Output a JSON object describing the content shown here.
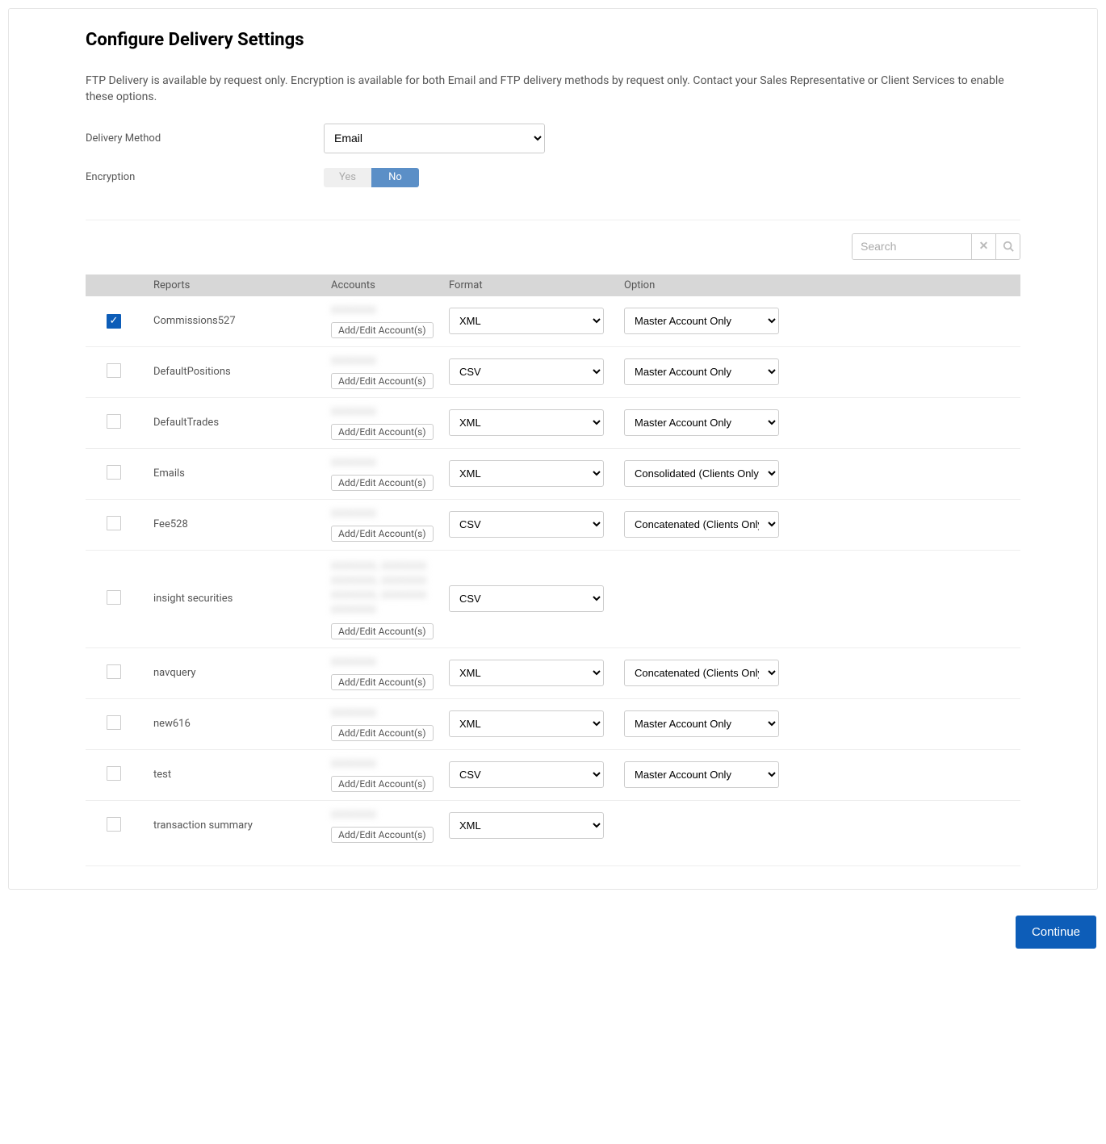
{
  "page": {
    "title": "Configure Delivery Settings",
    "intro": "FTP Delivery is available by request only. Encryption is available for both Email and FTP delivery methods by request only. Contact your Sales Representative or Client Services to enable these options."
  },
  "form": {
    "delivery_label": "Delivery Method",
    "delivery_value": "Email",
    "encryption_label": "Encryption",
    "encryption_yes": "Yes",
    "encryption_no": "No",
    "encryption_selected": "No"
  },
  "search": {
    "placeholder": "Search"
  },
  "table": {
    "headers": {
      "reports": "Reports",
      "accounts": "Accounts",
      "format": "Format",
      "option": "Option"
    },
    "addedit_label": "Add/Edit Account(s)",
    "rows": [
      {
        "checked": true,
        "report": "Commissions527",
        "accounts_blur": "XXXXXXX",
        "format": "XML",
        "option": "Master Account Only"
      },
      {
        "checked": false,
        "report": "DefaultPositions",
        "accounts_blur": "XXXXXXX",
        "format": "CSV",
        "option": "Master Account Only"
      },
      {
        "checked": false,
        "report": "DefaultTrades",
        "accounts_blur": "XXXXXXX",
        "format": "XML",
        "option": "Master Account Only"
      },
      {
        "checked": false,
        "report": "Emails",
        "accounts_blur": "XXXXXXX",
        "format": "XML",
        "option": "Consolidated (Clients Only)"
      },
      {
        "checked": false,
        "report": "Fee528",
        "accounts_blur": "XXXXXXX",
        "format": "CSV",
        "option": "Concatenated (Clients Only)"
      },
      {
        "checked": false,
        "report": "insight securities",
        "accounts_blur": "XXXXXXX, XXXXXXX\nXXXXXXX, XXXXXXX\nXXXXXXX, XXXXXXX\nXXXXXXX",
        "format": "CSV",
        "option": ""
      },
      {
        "checked": false,
        "report": "navquery",
        "accounts_blur": "XXXXXXX",
        "format": "XML",
        "option": "Concatenated (Clients Only)"
      },
      {
        "checked": false,
        "report": "new616",
        "accounts_blur": "XXXXXXX",
        "format": "XML",
        "option": "Master Account Only"
      },
      {
        "checked": false,
        "report": "test",
        "accounts_blur": "XXXXXXX",
        "format": "CSV",
        "option": "Master Account Only"
      },
      {
        "checked": false,
        "report": "transaction summary",
        "accounts_blur": "XXXXXXX",
        "format": "XML",
        "option": ""
      }
    ]
  },
  "footer": {
    "continue": "Continue"
  }
}
